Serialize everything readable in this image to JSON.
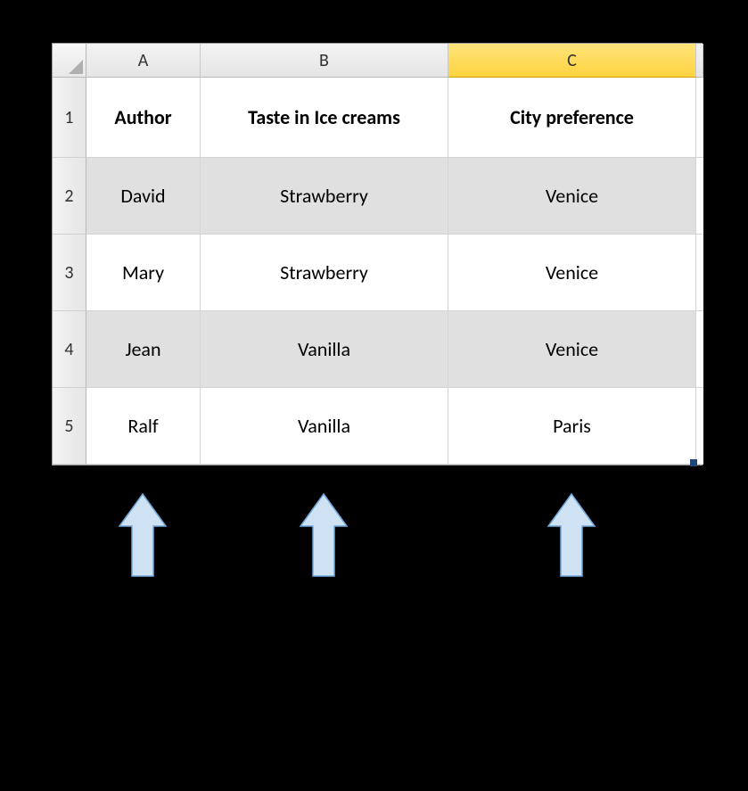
{
  "columns": [
    "A",
    "B",
    "C"
  ],
  "row_numbers": [
    "1",
    "2",
    "3",
    "4",
    "5"
  ],
  "headers": {
    "A": "Author",
    "B": "Taste in Ice creams",
    "C": "City preference"
  },
  "rows": [
    {
      "A": "David",
      "B": "Strawberry",
      "C": "Venice"
    },
    {
      "A": "Mary",
      "B": "Strawberry",
      "C": "Venice"
    },
    {
      "A": "Jean",
      "B": "Vanilla",
      "C": "Venice"
    },
    {
      "A": "Ralf",
      "B": "Vanilla",
      "C": "Paris"
    }
  ],
  "selected_column": "C",
  "chart_data": {
    "type": "table",
    "title": "",
    "columns": [
      "Author",
      "Taste in Ice creams",
      "City preference"
    ],
    "data": [
      [
        "David",
        "Strawberry",
        "Venice"
      ],
      [
        "Mary",
        "Strawberry",
        "Venice"
      ],
      [
        "Jean",
        "Vanilla",
        "Venice"
      ],
      [
        "Ralf",
        "Vanilla",
        "Paris"
      ]
    ]
  }
}
